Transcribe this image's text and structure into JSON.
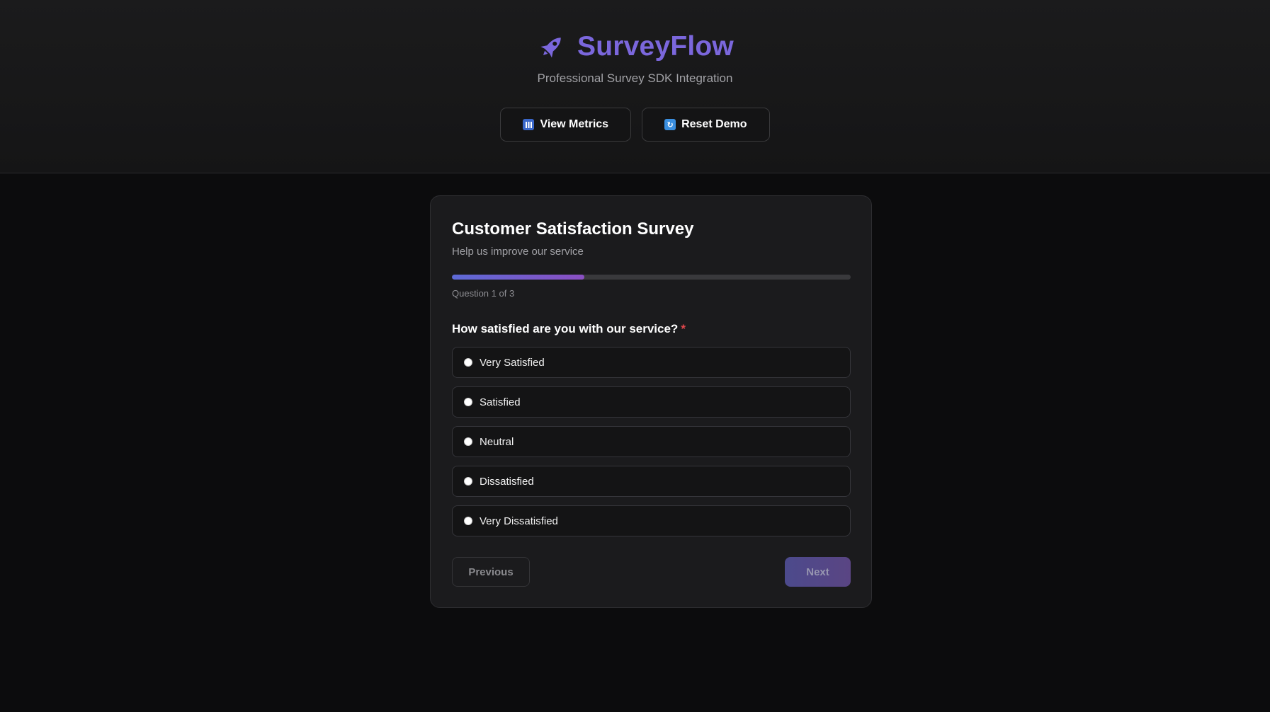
{
  "header": {
    "brand_icon": "rocket-icon",
    "brand_title": "SurveyFlow",
    "tagline": "Professional Survey SDK Integration",
    "view_metrics_icon": "bar-chart-icon",
    "view_metrics_label": "View Metrics",
    "reset_demo_icon": "refresh-icon",
    "reset_demo_label": "Reset Demo"
  },
  "survey": {
    "title": "Customer Satisfaction Survey",
    "subtitle": "Help us improve our service",
    "progress_fraction": 0.333,
    "progress_label": "Question 1 of 3",
    "question": "How satisfied are you with our service?",
    "required_marker": "*",
    "options": [
      {
        "label": "Very Satisfied"
      },
      {
        "label": "Satisfied"
      },
      {
        "label": "Neutral"
      },
      {
        "label": "Dissatisfied"
      },
      {
        "label": "Very Dissatisfied"
      }
    ],
    "previous_label": "Previous",
    "next_label": "Next"
  },
  "colors": {
    "brand": "#7b67dc",
    "required": "#e5484d",
    "progress_start": "#5d6ad6",
    "progress_end": "#8a4fc2"
  }
}
